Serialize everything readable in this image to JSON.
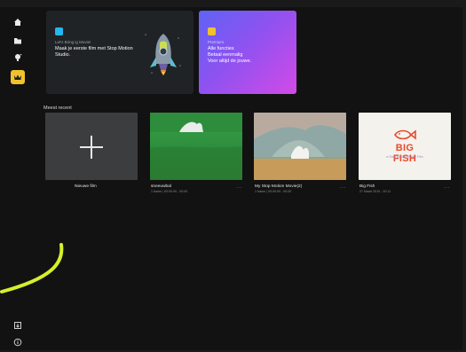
{
  "sidebar": {
    "items": [
      {
        "name": "home-icon"
      },
      {
        "name": "folder-icon"
      },
      {
        "name": "lightbulb-icon"
      },
      {
        "name": "crown-icon"
      }
    ],
    "bottom": [
      {
        "name": "import-icon"
      },
      {
        "name": "info-icon"
      }
    ]
  },
  "hero": {
    "main": {
      "kicker": "Let's Bring ig Movie!",
      "title": "Maak je eerste film met Stop Motion Studio."
    },
    "premium": {
      "kicker": "Premium",
      "lines": [
        "Alle functies",
        "Betaal eenmalig",
        "Voor altijd de jouwe."
      ]
    }
  },
  "recent": {
    "title": "Meest recent",
    "new_label": "Nieuwe film",
    "items": [
      {
        "title": "sneeuwbal",
        "meta": "1 frame | 00:00:00 - 00:00"
      },
      {
        "title": "My Stop Motion Movie(2)",
        "meta": "1 frame | 00:00:00 - 00:00"
      },
      {
        "title": "Big Fish",
        "meta": "27 Maart 2019 - 00:11"
      }
    ],
    "bigfish_logo": "BIG FISH",
    "bigfish_sub": "a Stop Motion Studio Film"
  },
  "colors": {
    "accent": "#f2c12e",
    "premium_start": "#5f63f4",
    "premium_end": "#d34ae7",
    "swoosh": "#d6ef2a"
  }
}
